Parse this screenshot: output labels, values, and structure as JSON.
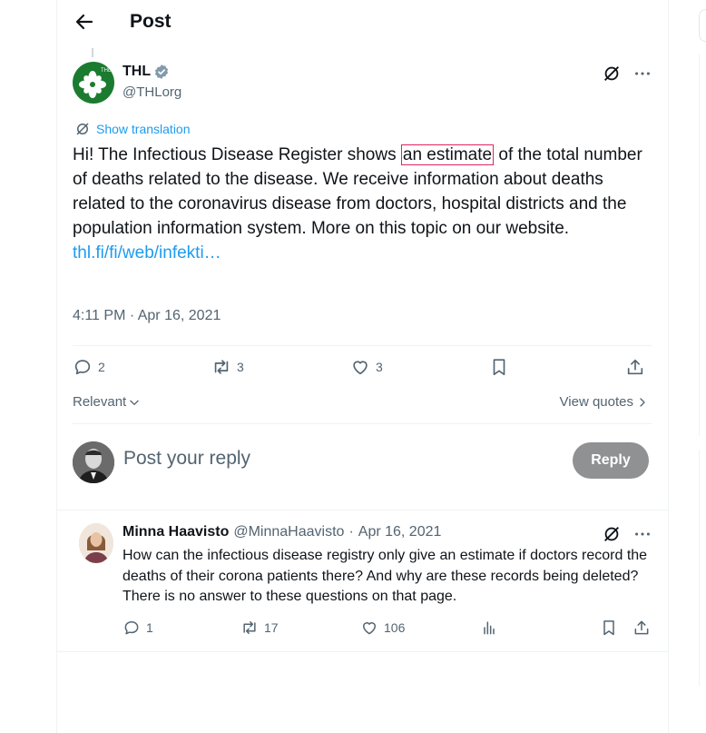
{
  "header": {
    "title": "Post"
  },
  "post": {
    "author_name": "THL",
    "author_handle": "@THLorg",
    "avatar_label": "THL",
    "show_translation": "Show translation",
    "text_before": "Hi! The Infectious Disease Register shows ",
    "text_highlight": "an estimate",
    "text_after": " of the total number of deaths related to the disease. We receive information about deaths related to the coronavirus disease from doctors, hospital districts and the population information system. More on this topic on our website.",
    "link": "thl.fi/fi/web/infekti…",
    "timestamp": "4:11 PM · Apr 16, 2021",
    "stats": {
      "replies": "2",
      "reposts": "3",
      "likes": "3"
    }
  },
  "sort": {
    "relevant": "Relevant",
    "view_quotes": "View quotes"
  },
  "composer": {
    "placeholder": "Post your reply",
    "reply_button": "Reply"
  },
  "reply": {
    "name": "Minna Haavisto",
    "handle": "@MinnaHaavisto",
    "dot": "·",
    "date": "Apr 16, 2021",
    "text": "How can the infectious disease registry only give an estimate if doctors record the deaths of their corona patients there? And why are these records being deleted? There is no answer to these questions on that page.",
    "stats": {
      "replies": "1",
      "reposts": "17",
      "likes": "106"
    }
  },
  "colors": {
    "accent": "#1d9bf0",
    "highlight_border": "#e0245e",
    "reply_button_bg": "#8f9192",
    "thl_green": "#1b7b2f"
  },
  "icons": [
    "back-arrow-icon",
    "verified-badge-icon",
    "grok-icon",
    "more-icon",
    "translate-icon",
    "reply-icon",
    "repost-icon",
    "like-icon",
    "bookmark-icon",
    "share-icon",
    "chevron-down-icon",
    "chevron-right-icon",
    "analytics-icon"
  ]
}
